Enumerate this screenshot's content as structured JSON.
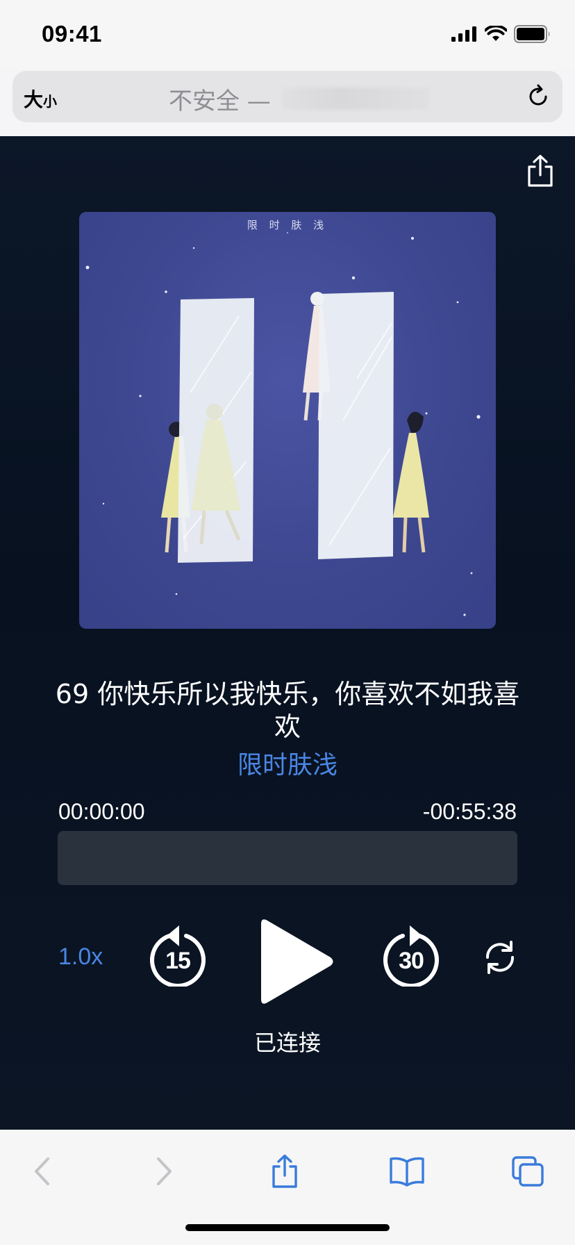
{
  "status_bar": {
    "time": "09:41"
  },
  "browser": {
    "text_size_label_big": "大",
    "text_size_label_small": "小",
    "url_prefix": "不安全 —"
  },
  "player": {
    "cover_title": "限 时 肤 浅",
    "track_title": "69 你快乐所以我快乐，你喜欢不如我喜欢",
    "album": "限时肤浅",
    "elapsed": "00:00:00",
    "remaining": "-00:55:38",
    "progress_fraction": 0,
    "speed": "1.0x",
    "skip_back_seconds": "15",
    "skip_forward_seconds": "30",
    "connection_status": "已连接"
  },
  "colors": {
    "accent": "#4a86e4",
    "player_bg": "#0a1424",
    "progress_track": "#2a323e",
    "cover_bg": "#3d478f"
  },
  "icons": {
    "top_share": "share-icon",
    "reload": "reload-icon",
    "toolbar": [
      "back-icon",
      "forward-icon",
      "share-icon",
      "bookmarks-icon",
      "tabs-icon"
    ],
    "loop": "loop-icon",
    "play": "play-icon"
  }
}
